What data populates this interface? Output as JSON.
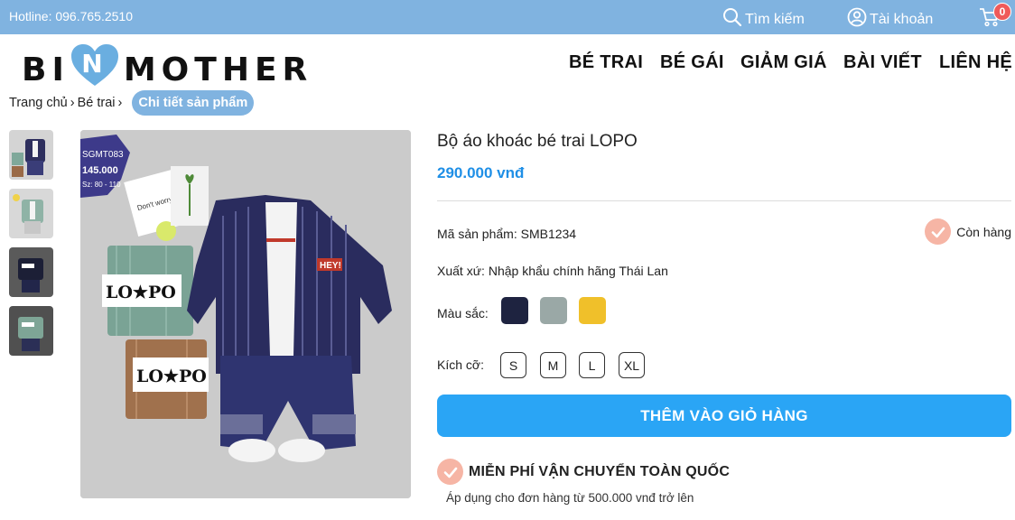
{
  "topbar": {
    "hotline": "Hotline: 096.765.2510",
    "search_label": "Tìm kiếm",
    "account_label": "Tài khoản",
    "cart_count": "0"
  },
  "logo": {
    "left": "BI",
    "heart_letter": "N",
    "right": "MOTHER"
  },
  "nav": {
    "items": [
      {
        "label": "BÉ TRAI"
      },
      {
        "label": "BÉ GÁI"
      },
      {
        "label": "GIẢM GIÁ"
      },
      {
        "label": "BÀI VIẾT"
      },
      {
        "label": "LIÊN HỆ"
      }
    ]
  },
  "breadcrumb": {
    "home": "Trang chủ",
    "category": "Bé trai",
    "current": "Chi tiết sản phẩm",
    "separator": "›"
  },
  "product": {
    "title": "Bộ áo khoác bé trai LOPO",
    "price": "290.000 vnđ",
    "sku_label": "Mã sản phẩm:",
    "sku": "SMB1234",
    "stock": "Còn hàng",
    "origin_label": "Xuất xứ:",
    "origin": "Nhập khẩu chính hãng Thái Lan",
    "color_label": "Màu sắc:",
    "colors": [
      "#1e2340",
      "#9aa8a6",
      "#f0c02a"
    ],
    "size_label": "Kích cỡ:",
    "sizes": [
      "S",
      "M",
      "L",
      "XL"
    ],
    "add_to_cart": "THÊM VÀO GIỎ HÀNG",
    "shipping_title": "MIỄN PHÍ VẬN CHUYỂN TOÀN QUỐC",
    "shipping_note": "Áp dụng cho đơn hàng từ 500.000 vnđ trở lên"
  },
  "image": {
    "tag_code": "SGMT083",
    "tag_price": "145.000",
    "tag_size": "Sz: 80 - 110",
    "card_text": "Don't worry, BE",
    "brand_text": "LO★PO",
    "patch_text": "HEY!"
  },
  "colors": {
    "topbar": "#80b3e0",
    "accent": "#1f8fe6",
    "cta": "#2aa5f5",
    "badge": "#ef5a5a",
    "check": "#f6b5a5",
    "logo_heart": "#6aaee0"
  }
}
